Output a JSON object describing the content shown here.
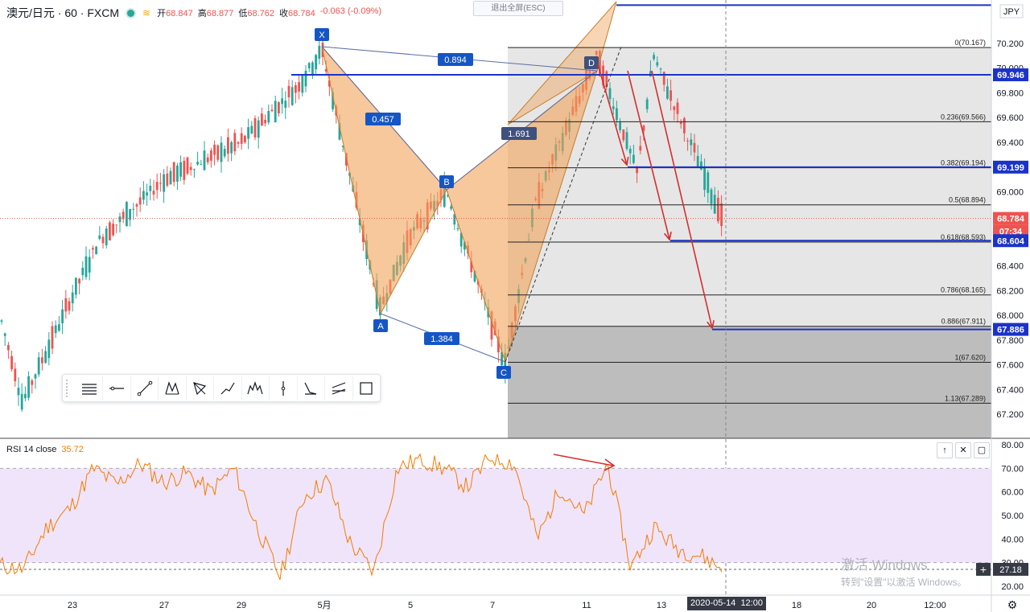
{
  "header": {
    "symbol": "澳元/日元 · 60 · FXCM",
    "open_label": "开",
    "open": "68.847",
    "high_label": "高",
    "high": "68.877",
    "low_label": "低",
    "low": "68.762",
    "close_label": "收",
    "close": "68.784",
    "change": "-0.063 (-0.09%)",
    "currency": "JPY"
  },
  "exit_fullscreen": "退出全屏(ESC)",
  "rsi": {
    "label": "RSI 14 close",
    "value": "35.72",
    "current_tag": "27.18"
  },
  "watermark": {
    "line1": "激活 Windows",
    "line2": "转到\"设置\"以激活 Windows。"
  },
  "crosshair": {
    "date": "2020-05-14",
    "time": "12:00"
  },
  "toolbar_icons": [
    "horizontal-lines-icon",
    "ray-icon",
    "trend-line-icon",
    "xabcd-pattern-icon",
    "triangle-pattern-icon",
    "path-icon",
    "elliott-wave-icon",
    "vertical-line-icon",
    "abcd-icon",
    "parallel-channel-icon",
    "rectangle-icon"
  ],
  "colors": {
    "up": "#26a69a",
    "down": "#ef5350",
    "pattern": "#f0a35a",
    "level": "#1b33c9",
    "rsi": "#f57c00",
    "arrow": "#d32f2f"
  },
  "chart_data": [
    {
      "type": "line",
      "subtype": "candlestick",
      "title": "澳元/日元 · 60 · FXCM",
      "x_ticks": [
        "23",
        "27",
        "29",
        "5月",
        "5",
        "7",
        "11",
        "13",
        "18",
        "20",
        "12:00"
      ],
      "y_ticks": [
        67.2,
        67.4,
        67.6,
        67.8,
        68.0,
        68.2,
        68.4,
        68.6,
        68.8,
        69.0,
        69.2,
        69.4,
        69.6,
        69.8,
        70.0,
        70.2
      ],
      "ylim": [
        67.08,
        70.36
      ],
      "price_tags": [
        {
          "value": "69.946",
          "color": "#1b33c9"
        },
        {
          "value": "69.199",
          "color": "#1b33c9"
        },
        {
          "value": "68.784",
          "color": "#ef5350"
        },
        {
          "value": "07:34",
          "color": "#ef5350"
        },
        {
          "value": "68.604",
          "color": "#1b33c9"
        },
        {
          "value": "67.886",
          "color": "#1b33c9"
        }
      ],
      "series": [
        {
          "name": "price_path",
          "x": [
            "04-21",
            "04-22",
            "04-24",
            "04-27",
            "04-29",
            "04-30",
            "05-01",
            "05-04",
            "05-05",
            "05-06",
            "05-07",
            "05-08",
            "05-11",
            "05-12",
            "05-13",
            "05-14"
          ],
          "values": [
            68.0,
            67.3,
            68.6,
            69.1,
            69.4,
            69.85,
            70.15,
            68.05,
            68.65,
            69.0,
            67.6,
            68.9,
            70.1,
            69.15,
            70.1,
            68.78
          ]
        }
      ],
      "harmonic_pattern": {
        "points": [
          {
            "label": "X",
            "value": 70.15
          },
          {
            "label": "A",
            "value": 68.0
          },
          {
            "label": "B",
            "value": 69.0
          },
          {
            "label": "C",
            "value": 67.62
          },
          {
            "label": "D",
            "value": 70.0
          }
        ],
        "ratios": [
          "0.894",
          "0.457",
          "1.691",
          "1.384"
        ]
      },
      "fibonacci": [
        {
          "label": "0(70.167)",
          "value": 70.167
        },
        {
          "label": "0.236(69.566)",
          "value": 69.566
        },
        {
          "label": "0.382(69.194)",
          "value": 69.194
        },
        {
          "label": "0.5(68.894)",
          "value": 68.894
        },
        {
          "label": "0.618(68.593)",
          "value": 68.593
        },
        {
          "label": "0.786(68.165)",
          "value": 68.165
        },
        {
          "label": "0.886(67.911)",
          "value": 67.911
        },
        {
          "label": "1(67.620)",
          "value": 67.62
        },
        {
          "label": "1.13(67.289)",
          "value": 67.289
        }
      ],
      "levels": [
        69.946,
        69.199,
        68.604,
        67.886,
        70.5
      ]
    },
    {
      "type": "line",
      "title": "RSI 14 close",
      "y_ticks": [
        20,
        30,
        40,
        50,
        60,
        70,
        80
      ],
      "ylim": [
        16,
        82
      ],
      "band": [
        30,
        70
      ],
      "series": [
        {
          "name": "RSI 14 close",
          "values": [
            29,
            27,
            45,
            53,
            70,
            63,
            72,
            64,
            68,
            60,
            70,
            45,
            24,
            58,
            65,
            38,
            26,
            70,
            74,
            70,
            62,
            75,
            72,
            40,
            62,
            50,
            72,
            28,
            45,
            36,
            33,
            27
          ]
        }
      ]
    }
  ]
}
